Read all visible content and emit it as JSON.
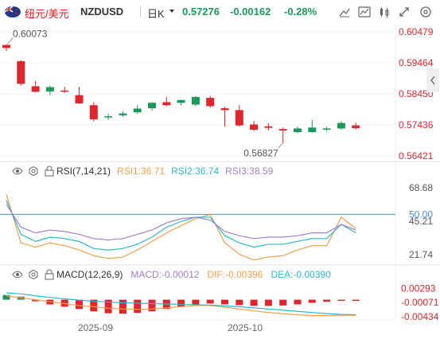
{
  "header": {
    "pair_cn": "纽元/美元",
    "pair": "NZDUSD",
    "timeframe": "日K",
    "price": "0.57276",
    "change": "-0.00162",
    "change_pct": "-0.28%",
    "up_color": "#e0262d",
    "down_color": "#1a9a5a"
  },
  "main_chart": {
    "price_labels": [
      "0.60479",
      "0.59464",
      "0.58450",
      "0.57436",
      "0.56421"
    ],
    "high_label": "0.60073",
    "low_label": "0.56827",
    "last_price_line": "0.57276"
  },
  "rsi_panel": {
    "title": "RSI(7,14,21)",
    "rsi1": "RSI1:36.71",
    "rsi2": "RSI2:36.74",
    "rsi3": "RSI3:38.59",
    "levels": [
      "68.68",
      "50.00",
      "45.21",
      "21.74"
    ],
    "colors": {
      "rsi1": "#f0a050",
      "rsi2": "#30b8c8",
      "rsi3": "#a080d0",
      "ref": "#4a90d9"
    }
  },
  "macd_panel": {
    "title": "MACD(12,26,9)",
    "macd": "MACD:-0.00012",
    "dif": "DIF:-0.00396",
    "dea": "DEA:-0.00390",
    "levels": [
      "0.00293",
      "-0.00071",
      "-0.00434"
    ],
    "colors": {
      "macd": "#a080d0",
      "dif": "#f0a050",
      "dea": "#30b8c8"
    }
  },
  "x_axis": [
    "2025-09",
    "2025-10"
  ],
  "candles": [
    {
      "o": 0.6005,
      "c": 0.5995,
      "h": 0.6007,
      "l": 0.5985
    },
    {
      "o": 0.5952,
      "c": 0.5878,
      "h": 0.5955,
      "l": 0.5872
    },
    {
      "o": 0.587,
      "c": 0.5852,
      "h": 0.5888,
      "l": 0.585
    },
    {
      "o": 0.5853,
      "c": 0.5867,
      "h": 0.5872,
      "l": 0.584
    },
    {
      "o": 0.5856,
      "c": 0.5852,
      "h": 0.5868,
      "l": 0.5848
    },
    {
      "o": 0.5841,
      "c": 0.5814,
      "h": 0.5868,
      "l": 0.5812
    },
    {
      "o": 0.5808,
      "c": 0.5762,
      "h": 0.5818,
      "l": 0.5755
    },
    {
      "o": 0.577,
      "c": 0.5772,
      "h": 0.578,
      "l": 0.576
    },
    {
      "o": 0.5775,
      "c": 0.5781,
      "h": 0.5788,
      "l": 0.577
    },
    {
      "o": 0.5785,
      "c": 0.5797,
      "h": 0.5808,
      "l": 0.578
    },
    {
      "o": 0.5798,
      "c": 0.5816,
      "h": 0.5818,
      "l": 0.579
    },
    {
      "o": 0.5818,
      "c": 0.5808,
      "h": 0.5835,
      "l": 0.5804
    },
    {
      "o": 0.5816,
      "c": 0.5825,
      "h": 0.5826,
      "l": 0.5807
    },
    {
      "o": 0.581,
      "c": 0.5835,
      "h": 0.5838,
      "l": 0.5805
    },
    {
      "o": 0.5832,
      "c": 0.5805,
      "h": 0.5838,
      "l": 0.58
    },
    {
      "o": 0.5798,
      "c": 0.5792,
      "h": 0.5802,
      "l": 0.5738
    },
    {
      "o": 0.5792,
      "c": 0.5742,
      "h": 0.5808,
      "l": 0.5738
    },
    {
      "o": 0.5745,
      "c": 0.5728,
      "h": 0.5757,
      "l": 0.5724
    },
    {
      "o": 0.5739,
      "c": 0.5734,
      "h": 0.5749,
      "l": 0.5725
    },
    {
      "o": 0.573,
      "c": 0.5725,
      "h": 0.5735,
      "l": 0.5683
    },
    {
      "o": 0.572,
      "c": 0.5732,
      "h": 0.5738,
      "l": 0.5718
    },
    {
      "o": 0.572,
      "c": 0.5735,
      "h": 0.576,
      "l": 0.5718
    },
    {
      "o": 0.5731,
      "c": 0.5732,
      "h": 0.5738,
      "l": 0.5722
    },
    {
      "o": 0.5732,
      "c": 0.575,
      "h": 0.5756,
      "l": 0.5728
    },
    {
      "o": 0.5742,
      "c": 0.5733,
      "h": 0.5751,
      "l": 0.5729
    }
  ],
  "rsi_series": {
    "rsi1": [
      64,
      30,
      27,
      30,
      28,
      25,
      21,
      19,
      20,
      25,
      31,
      37,
      42,
      47,
      50,
      30,
      22,
      18,
      20,
      21,
      25,
      28,
      28,
      48,
      40
    ],
    "rsi2": [
      60,
      36,
      31,
      34,
      33,
      31,
      26,
      25,
      26,
      29,
      34,
      41,
      45,
      48,
      48,
      35,
      30,
      27,
      29,
      29,
      31,
      33,
      33,
      43,
      37
    ],
    "rsi3": [
      57,
      41,
      37,
      39,
      38,
      36,
      33,
      32,
      33,
      36,
      39,
      44,
      47,
      48,
      46,
      38,
      35,
      33,
      34,
      34,
      35,
      37,
      37,
      43,
      39
    ]
  },
  "macd_series": {
    "hist": [
      0.0012,
      0.0008,
      -0.0004,
      -0.0012,
      -0.0018,
      -0.0024,
      -0.003,
      -0.0035,
      -0.0036,
      -0.0034,
      -0.003,
      -0.0024,
      -0.0018,
      -0.0012,
      -0.001,
      -0.0012,
      -0.0014,
      -0.0016,
      -0.0016,
      -0.0015,
      -0.0012,
      -0.0008,
      -0.0005,
      -0.0002,
      -0.0001
    ],
    "dif": [
      0.001,
      0.0005,
      0.0,
      -0.0005,
      -0.001,
      -0.0015,
      -0.0018,
      -0.0022,
      -0.0024,
      -0.0025,
      -0.0024,
      -0.0021,
      -0.0018,
      -0.0015,
      -0.0015,
      -0.0019,
      -0.0024,
      -0.0029,
      -0.0033,
      -0.0036,
      -0.0039,
      -0.0041,
      -0.0041,
      -0.004,
      -0.004
    ],
    "dea": [
      0.0018,
      0.0015,
      0.001,
      0.0006,
      0.0002,
      -0.0001,
      -0.0004,
      -0.0006,
      -0.0008,
      -0.0009,
      -0.001,
      -0.0011,
      -0.0012,
      -0.0013,
      -0.0014,
      -0.0016,
      -0.0018,
      -0.0021,
      -0.0024,
      -0.0027,
      -0.003,
      -0.0033,
      -0.0036,
      -0.0038,
      -0.0039
    ]
  }
}
